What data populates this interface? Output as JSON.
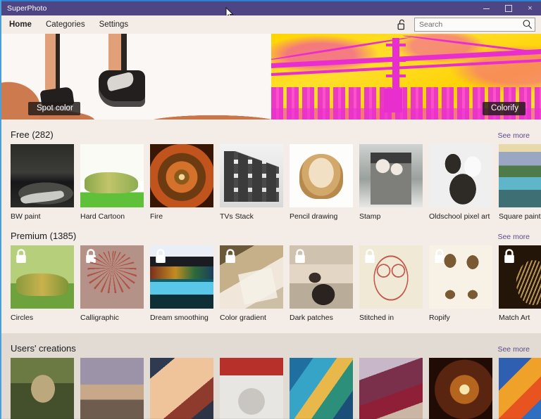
{
  "window": {
    "title": "SuperPhoto",
    "controls": {
      "minimize": "minimize-button",
      "maximize": "maximize-button",
      "close": "×"
    }
  },
  "nav": {
    "items": [
      {
        "label": "Home",
        "active": true
      },
      {
        "label": "Categories",
        "active": false
      },
      {
        "label": "Settings",
        "active": false
      }
    ],
    "lock_icon": "unlock-icon",
    "search": {
      "placeholder": "Search",
      "value": "",
      "icon": "search-icon"
    }
  },
  "banners": [
    {
      "label": "Spot color",
      "art": "spot-color-runner"
    },
    {
      "label": "Colorify",
      "art": "colorify-bridge"
    }
  ],
  "sections": [
    {
      "id": "free",
      "title": "Free (282)",
      "see_more": "See more",
      "locked": false,
      "items": [
        {
          "label": "BW paint"
        },
        {
          "label": "Hard Cartoon"
        },
        {
          "label": "Fire"
        },
        {
          "label": "TVs Stack"
        },
        {
          "label": "Pencil drawing"
        },
        {
          "label": "Stamp"
        },
        {
          "label": "Oldschool pixel art"
        },
        {
          "label": "Square paint"
        }
      ]
    },
    {
      "id": "premium",
      "title": "Premium (1385)",
      "see_more": "See more",
      "locked": true,
      "lock_icon": "padlock-icon",
      "items": [
        {
          "label": "Circles"
        },
        {
          "label": "Calligraphic"
        },
        {
          "label": "Dream smoothing"
        },
        {
          "label": "Color gradient"
        },
        {
          "label": "Dark patches"
        },
        {
          "label": "Stitched in"
        },
        {
          "label": "Ropify"
        },
        {
          "label": "Match Art"
        }
      ]
    },
    {
      "id": "users",
      "title": "Users' creations",
      "see_more": "See more",
      "locked": false,
      "items": [
        {
          "label": ""
        },
        {
          "label": ""
        },
        {
          "label": ""
        },
        {
          "label": ""
        },
        {
          "label": ""
        },
        {
          "label": ""
        },
        {
          "label": ""
        },
        {
          "label": ""
        }
      ]
    }
  ],
  "colors": {
    "titlebar": "#4e4585",
    "titlebar_accent": "#2f7fd0",
    "page_background": "#f4ece7",
    "users_band": "#e1dbd4",
    "link": "#5b4c8a",
    "text": "#1d1d1d"
  }
}
